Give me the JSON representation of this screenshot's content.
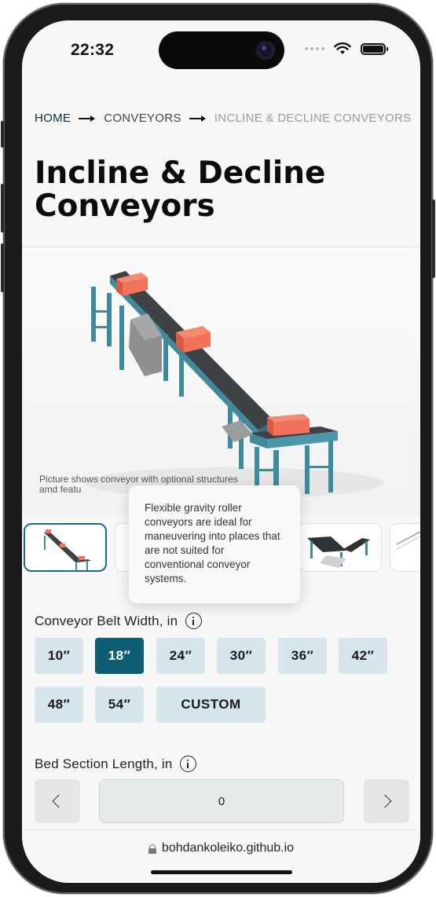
{
  "status": {
    "time": "22:32",
    "wifi_icon": "wifi-icon",
    "battery_icon": "battery-icon"
  },
  "breadcrumb": {
    "home": "HOME",
    "middle": "CONVEYORS",
    "current": "INCLINE & DECLINE CONVEYORS"
  },
  "page": {
    "title": "Incline & Decline Conveyors",
    "caption": "Picture shows conveyor with optional structures amd featu"
  },
  "tooltip": {
    "text": "Flexible gravity roller conveyors are ideal for maneuvering into places that are not suited for conventional conveyor systems."
  },
  "belt_width": {
    "label": "Conveyor Belt Width, in",
    "options": [
      "10″",
      "18″",
      "24″",
      "30″",
      "36″",
      "42″",
      "48″",
      "54″",
      "CUSTOM"
    ],
    "selected": "18″"
  },
  "bed_length": {
    "label": "Bed Section Length, in",
    "value": "0"
  },
  "browser": {
    "url": "bohdankoleiko.github.io"
  },
  "colors": {
    "accent": "#0f5d72",
    "option_bg": "#d6e6ec",
    "conveyor_frame": "#3f8a9c",
    "crate": "#f2725a"
  }
}
